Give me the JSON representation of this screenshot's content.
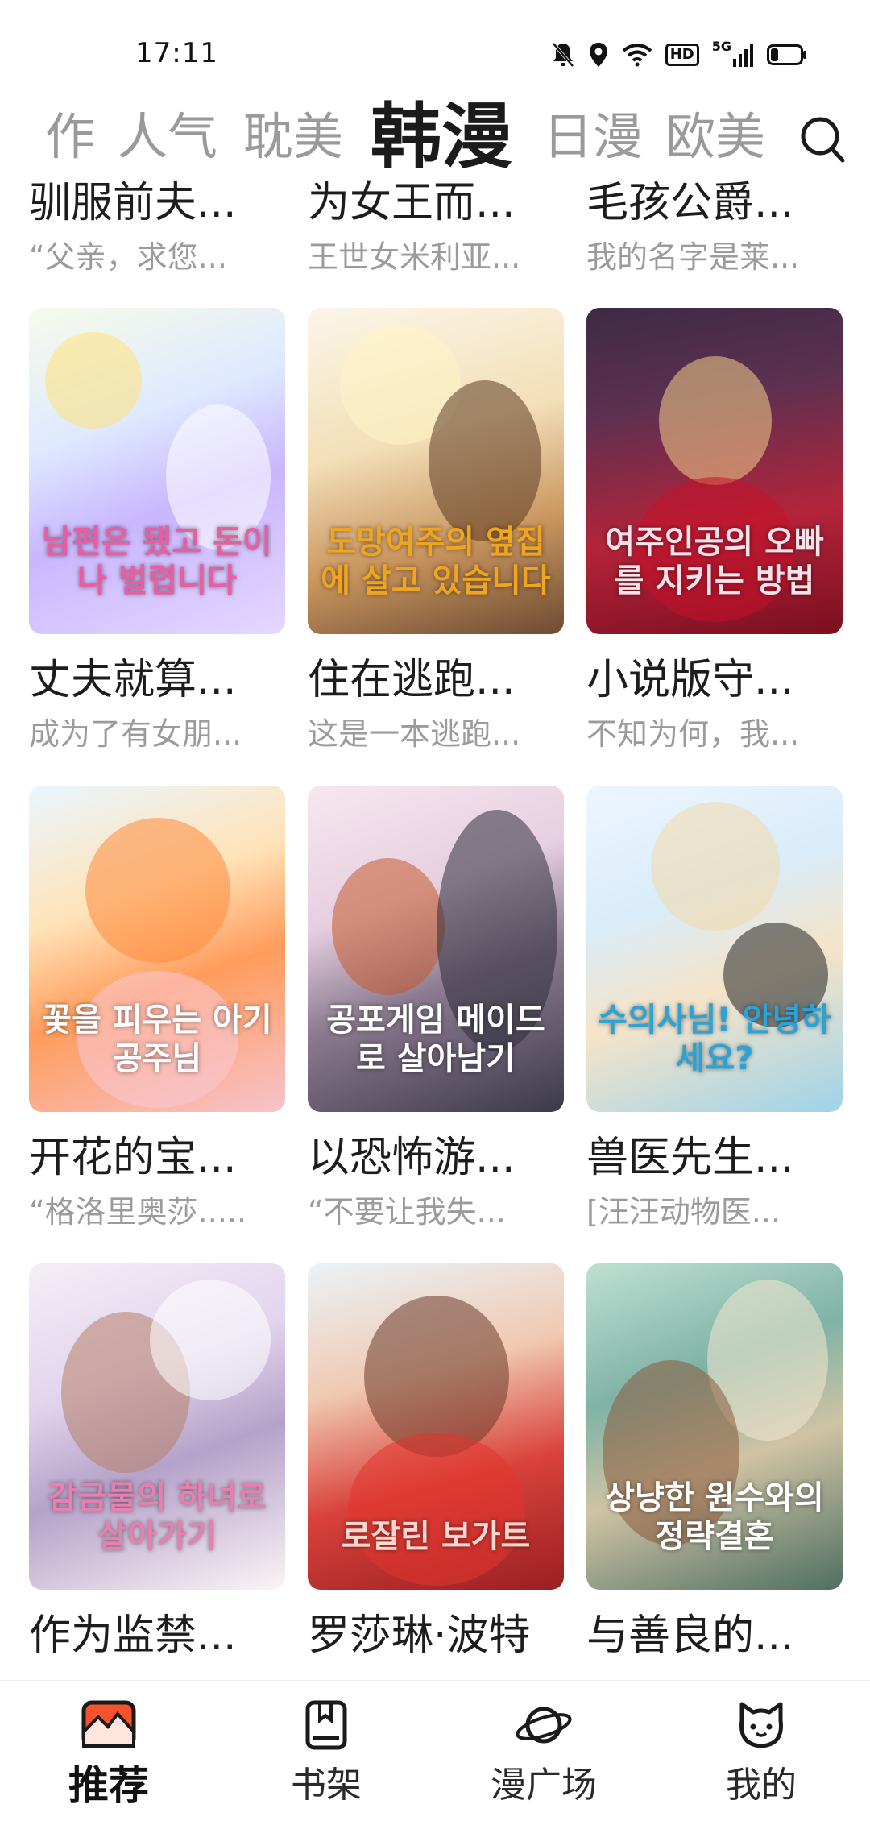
{
  "status_bar": {
    "time": "17:11",
    "icons": [
      "mute-icon",
      "location-icon",
      "wifi-icon",
      "hd-icon",
      "signal-5g-icon",
      "battery-icon"
    ],
    "hd_label": "HD",
    "network_label": "5G"
  },
  "category_tabs": {
    "items": [
      "作",
      "人气",
      "耽美",
      "韩漫",
      "日漫",
      "欧美"
    ],
    "active_index": 3
  },
  "partial_row": [
    {
      "title": "驯服前夫...",
      "desc": "“父亲，求您..."
    },
    {
      "title": "为女王而...",
      "desc": "王世女米利亚..."
    },
    {
      "title": "毛孩公爵...",
      "desc": "我的名字是莱..."
    }
  ],
  "comics": [
    {
      "title": "丈夫就算...",
      "desc": "成为了有女朋...",
      "cover_text": "남편은 됐고 돈이나 벌렵니다"
    },
    {
      "title": "住在逃跑...",
      "desc": "这是一本逃跑...",
      "cover_text": "도망여주의 옆집에 살고 있습니다"
    },
    {
      "title": "小说版守...",
      "desc": "不知为何，我...",
      "cover_text": "여주인공의 오빠를 지키는 방법"
    },
    {
      "title": "开花的宝...",
      "desc": "“格洛里奥莎.....",
      "cover_text": "꽃을 피우는 아기 공주님"
    },
    {
      "title": "以恐怖游...",
      "desc": "“不要让我失...",
      "cover_text": "공포게임 메이드로 살아남기"
    },
    {
      "title": "兽医先生...",
      "desc": "[汪汪动物医...",
      "cover_text": "수의사님! 안녕하세요?"
    },
    {
      "title": "作为监禁...",
      "desc": "",
      "cover_text": "감금물의 하녀로 살아가기"
    },
    {
      "title": "罗莎琳·波特",
      "desc": "",
      "cover_text": "로잘린 보가트"
    },
    {
      "title": "与善良的...",
      "desc": "",
      "cover_text": "상냥한 원수와의 정략결혼"
    }
  ],
  "bottom_nav": {
    "items": [
      {
        "label": "推荐",
        "icon": "recommend-icon"
      },
      {
        "label": "书架",
        "icon": "bookshelf-icon"
      },
      {
        "label": "漫广场",
        "icon": "planet-icon"
      },
      {
        "label": "我的",
        "icon": "cat-face-icon"
      }
    ],
    "active_index": 0
  },
  "colors": {
    "active_tab": "#1b1b1b",
    "inactive_tab": "#9a9a9a",
    "nav_accent": "#f5532b"
  }
}
